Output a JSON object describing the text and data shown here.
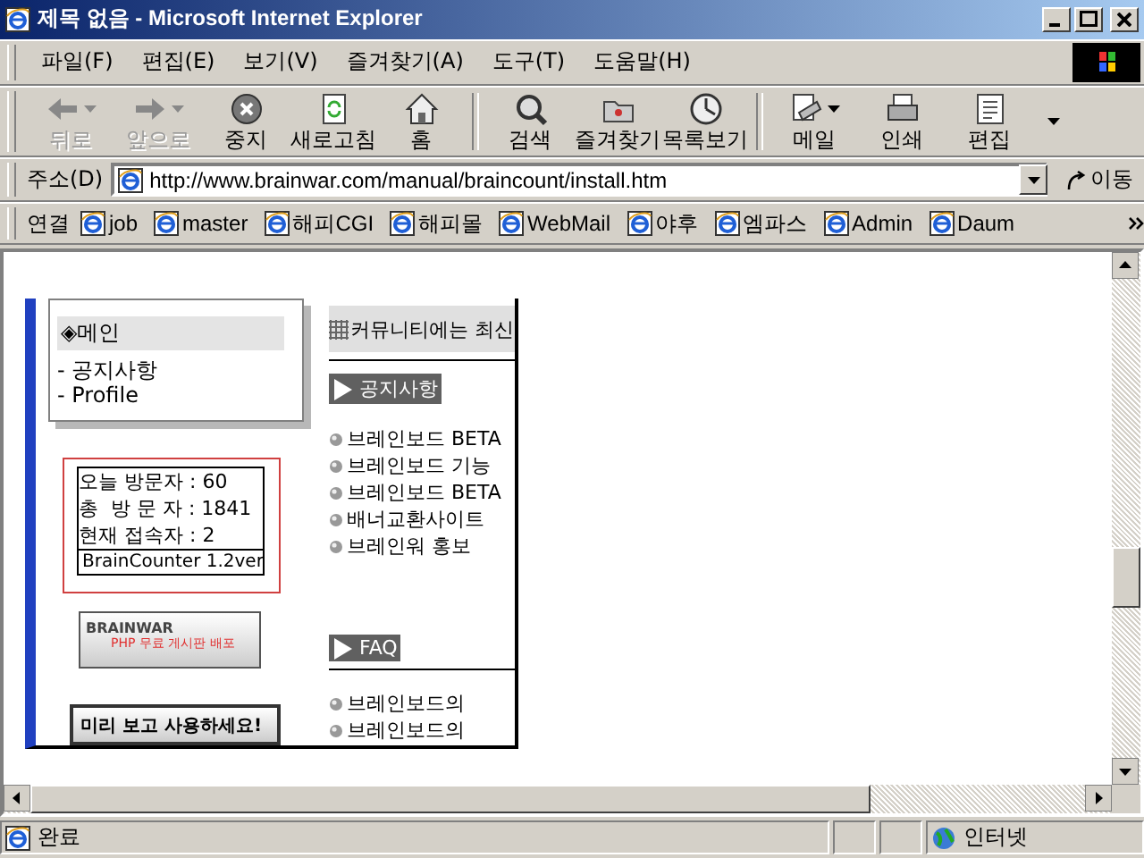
{
  "window": {
    "title": "제목 없음 - Microsoft Internet Explorer"
  },
  "menu": [
    "파일(F)",
    "편집(E)",
    "보기(V)",
    "즐겨찾기(A)",
    "도구(T)",
    "도움말(H)"
  ],
  "toolbar": [
    {
      "buttons": [
        {
          "label": "뒤로",
          "disabled": true,
          "dropdown": true
        },
        {
          "label": "앞으로",
          "disabled": true,
          "dropdown": true
        },
        {
          "label": "중지",
          "disabled": false,
          "dropdown": false
        },
        {
          "label": "새로고침",
          "disabled": false,
          "dropdown": false
        },
        {
          "label": "홈",
          "disabled": false,
          "dropdown": false
        }
      ]
    },
    {
      "buttons": [
        {
          "label": "검색",
          "disabled": false,
          "dropdown": false
        },
        {
          "label": "즐겨찾기",
          "disabled": false,
          "dropdown": false
        },
        {
          "label": "목록보기",
          "disabled": false,
          "dropdown": false
        }
      ]
    },
    {
      "buttons": [
        {
          "label": "메일",
          "disabled": false,
          "dropdown": true
        },
        {
          "label": "인쇄",
          "disabled": false,
          "dropdown": false
        },
        {
          "label": "편집",
          "disabled": false,
          "dropdown": false
        }
      ]
    }
  ],
  "address": {
    "label": "주소(D)",
    "value": "http://www.brainwar.com/manual/braincount/install.htm",
    "go": "이동"
  },
  "links": {
    "label": "연결",
    "items": [
      "job",
      "master",
      "해피CGI",
      "해피몰",
      "WebMail",
      "야후",
      "엠파스",
      "Admin",
      "Daum"
    ]
  },
  "page": {
    "sidebar": {
      "heading": "◈메인",
      "items": [
        "- 공지사항",
        "- Profile"
      ]
    },
    "counter": {
      "lines": [
        "오늘 방문자 : 60",
        "총  방 문 자 : 1841",
        "현재 접속자 : 2"
      ],
      "footer": "BrainCounter 1.2ver"
    },
    "banner": {
      "title": "BRAINWAR",
      "subtitle": "PHP 무료 게시판 배포"
    },
    "preview": "미리 보고 사용하세요!",
    "header": "커뮤니티에는 최신",
    "sections": [
      {
        "title": "공지사항",
        "items": [
          "브레인보드 BETA",
          "브레인보드 기능",
          "브레인보드 BETA",
          "배너교환사이트",
          "브레인워 홍보"
        ]
      },
      {
        "title": "FAQ",
        "items": [
          "브레인보드의",
          "브레인보드의"
        ]
      }
    ]
  },
  "status_bar": {
    "text": "완료",
    "zone": "인터넷"
  }
}
